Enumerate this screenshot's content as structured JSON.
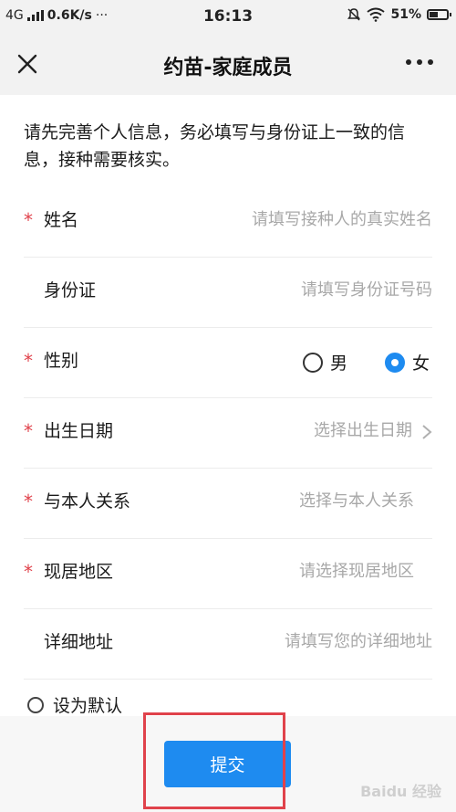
{
  "status_bar": {
    "network": "4G",
    "speed": "0.6K/s",
    "more": "···",
    "time": "16:13",
    "battery": "51%",
    "battery_level": 0.51
  },
  "nav": {
    "title": "约苗-家庭成员"
  },
  "intro": "请先完善个人信息，务必填写与身份证上一致的信息，接种需要核实。",
  "form": {
    "required_mark": "*",
    "name": {
      "label": "姓名",
      "placeholder": "请填写接种人的真实姓名"
    },
    "id_card": {
      "label": "身份证",
      "placeholder": "请填写身份证号码"
    },
    "gender": {
      "label": "性别",
      "male": "男",
      "female": "女",
      "selected": "女"
    },
    "birth_date": {
      "label": "出生日期",
      "placeholder": "选择出生日期"
    },
    "relation": {
      "label": "与本人关系",
      "placeholder": "选择与本人关系"
    },
    "region": {
      "label": "现居地区",
      "placeholder": "请选择现居地区"
    },
    "address": {
      "label": "详细地址",
      "placeholder": "请填写您的详细地址"
    },
    "set_default": "设为默认"
  },
  "submit_label": "提交",
  "watermark": "Baidu 经验",
  "colors": {
    "accent": "#1e8bf0",
    "required": "#e0424b",
    "highlight": "#e0424b"
  }
}
